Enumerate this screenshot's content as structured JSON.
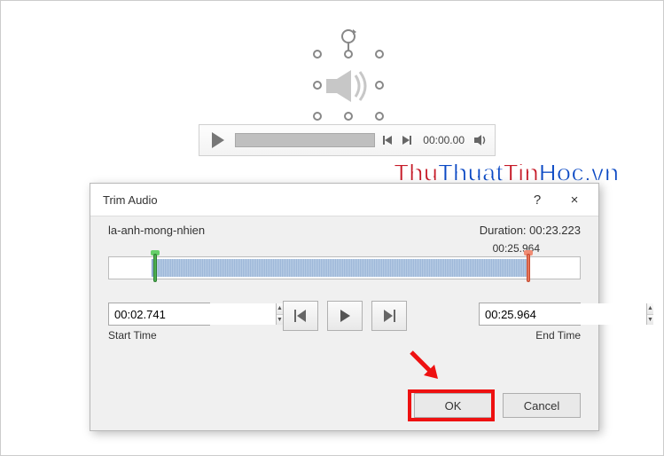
{
  "player": {
    "current_time": "00:00.00"
  },
  "watermark": {
    "thu": "Thu",
    "thuat": "Thuat",
    "tin": "Tin",
    "hoc": "Hoc",
    "vn": ".vn"
  },
  "dialog": {
    "title": "Trim Audio",
    "help": "?",
    "close": "×",
    "file_name": "la-anh-mong-nhien",
    "duration_label": "Duration: 00:23.223",
    "end_marker_time": "00:25.964",
    "start_time": {
      "value": "00:02.741",
      "label": "Start Time"
    },
    "end_time": {
      "value": "00:25.964",
      "label": "End Time"
    },
    "buttons": {
      "ok": "OK",
      "cancel": "Cancel"
    }
  }
}
